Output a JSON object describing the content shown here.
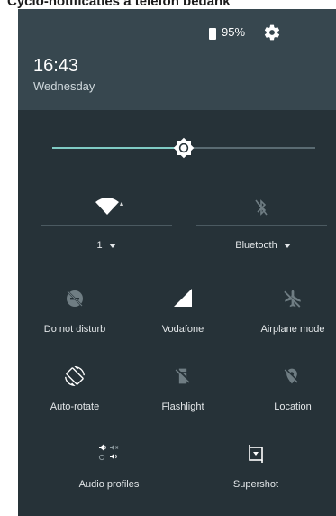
{
  "caption": "Cyclo-notificaties a telefon bedank",
  "status": {
    "battery_percent": "95%",
    "battery_icon": "battery-icon",
    "settings_icon": "gear-icon"
  },
  "header": {
    "time": "16:43",
    "day": "Wednesday"
  },
  "brightness": {
    "level": 0.5
  },
  "wifi": {
    "label": "1",
    "icon": "wifi-icon"
  },
  "bluetooth": {
    "label": "Bluetooth",
    "icon": "bluetooth-off-icon"
  },
  "tiles": {
    "dnd": "Do not disturb",
    "vodafone": "Vodafone",
    "airplane": "Airplane mode",
    "autorotate": "Auto-rotate",
    "flashlight": "Flashlight",
    "location": "Location",
    "audio": "Audio profiles",
    "supershot": "Supershot"
  },
  "colors": {
    "panel_bg": "#263238",
    "header_bg": "#37474f",
    "accent": "#80cbc4"
  }
}
